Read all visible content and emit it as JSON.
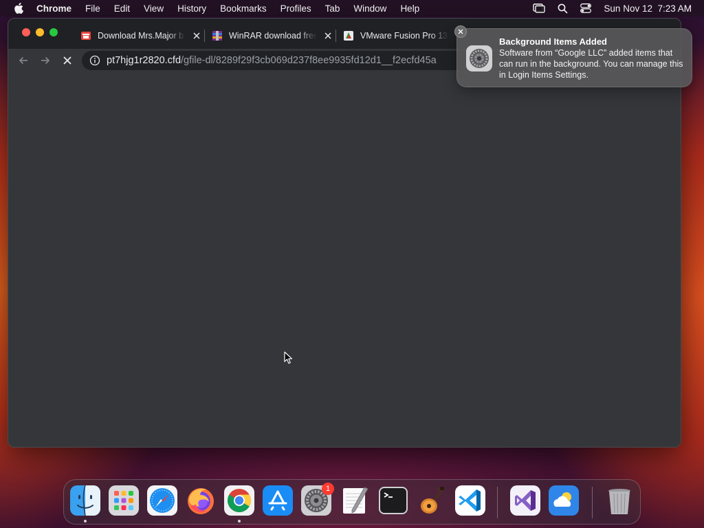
{
  "menubar": {
    "app_name": "Chrome",
    "items": [
      "File",
      "Edit",
      "View",
      "History",
      "Bookmarks",
      "Profiles",
      "Tab",
      "Window",
      "Help"
    ],
    "clock": "Sun Nov 12  7:23 AM"
  },
  "browser": {
    "tabs": [
      {
        "title": "Download Mrs.Major b",
        "favicon": "sourceforge-like-icon"
      },
      {
        "title": "WinRAR download free",
        "favicon": "winrar-icon"
      },
      {
        "title": "VMware Fusion Pro 13",
        "favicon": "vmware-icon"
      }
    ],
    "address": {
      "host": "pt7hjg1r2820.cfd",
      "path": "/gfile-dl/8289f29f3cb069d237f8ee9935fd12d1__f2ecfd45a"
    },
    "loading": true
  },
  "notification": {
    "title": "Background Items Added",
    "body": "Software from “Google LLC” added items that can run in the background. You can manage this in Login Items Settings.",
    "app_icon": "system-settings-icon"
  },
  "dock": {
    "apps": [
      "Finder",
      "Launchpad",
      "Safari",
      "Firefox",
      "Google Chrome",
      "App Store",
      "System Settings",
      "TextEdit",
      "Terminal",
      "GarageBand",
      "Visual Studio Code",
      "Visual Studio",
      "Weather",
      "Trash"
    ],
    "system_settings_badge": "1"
  },
  "colors": {
    "window_bg": "#35363a",
    "tabstrip_bg": "#202124",
    "badge": "#ff3b30"
  }
}
